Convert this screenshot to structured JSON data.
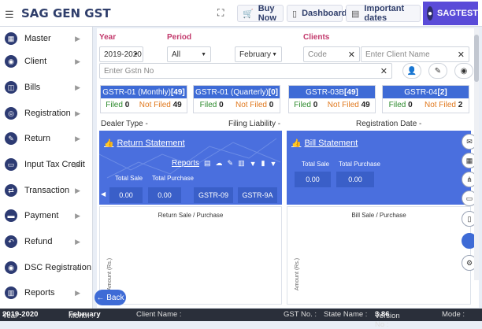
{
  "app": {
    "title": "SAG GEN GST"
  },
  "topbar": {
    "buy_now": "Buy Now",
    "dashboard": "Dashboard",
    "important_dates": "Important dates",
    "user": "SAGTEST"
  },
  "sidebar": {
    "items": [
      {
        "label": "Master",
        "icon": "master-icon"
      },
      {
        "label": "Client",
        "icon": "client-icon"
      },
      {
        "label": "Bills",
        "icon": "bills-icon"
      },
      {
        "label": "Registration",
        "icon": "registration-icon"
      },
      {
        "label": "Return",
        "icon": "return-icon"
      },
      {
        "label": "Input Tax Credit",
        "icon": "input-tax-credit-icon"
      },
      {
        "label": "Transaction",
        "icon": "transaction-icon"
      },
      {
        "label": "Payment",
        "icon": "payment-icon"
      },
      {
        "label": "Refund",
        "icon": "refund-icon"
      },
      {
        "label": "DSC Registration",
        "icon": "dsc-icon"
      },
      {
        "label": "Reports",
        "icon": "reports-icon"
      }
    ]
  },
  "filters": {
    "year_label": "Year",
    "year_value": "2019-2020",
    "period_label": "Period",
    "period_value": "All",
    "month_value": "February",
    "clients_label": "Clients",
    "code_placeholder": "Code",
    "client_name_placeholder": "Enter Client Name",
    "gstn_placeholder": "Enter Gstn No"
  },
  "gst_cards": [
    {
      "title": "GSTR-01 (Monthly) ",
      "count": "[49]",
      "filed_label": "Filed",
      "filed": "0",
      "not_filed_label": "Not Filed",
      "not_filed": "49"
    },
    {
      "title": "GSTR-01 (Quarterly) ",
      "count": "[0]",
      "filed_label": "Filed",
      "filed": "0",
      "not_filed_label": "Not Filed",
      "not_filed": "0"
    },
    {
      "title": "GSTR-03B ",
      "count": "[49]",
      "filed_label": "Filed",
      "filed": "0",
      "not_filed_label": "Not Filed",
      "not_filed": "49"
    },
    {
      "title": "GSTR-04 ",
      "count": "[2]",
      "filed_label": "Filed",
      "filed": "0",
      "not_filed_label": "Not Filed",
      "not_filed": "2"
    }
  ],
  "labels": {
    "dealer_type": "Dealer Type -",
    "filing_liability": "Filing Liability -",
    "registration_date": "Registration Date -"
  },
  "return_statement": {
    "title": "Return Statement",
    "reports": "Reports",
    "total_sale_label": "Total Sale",
    "total_purchase_label": "Total Purchase",
    "total_sale": "0.00",
    "total_purchase": "0.00",
    "gstr09": "GSTR-09",
    "gstr9a": "GSTR-9A"
  },
  "bill_statement": {
    "title": "Bill Statement",
    "total_sale_label": "Total Sale",
    "total_purchase_label": "Total Purchase",
    "total_sale": "0.00",
    "total_purchase": "0.00"
  },
  "charts": {
    "left_title": "Return Sale / Purchase",
    "right_title": "Bill Sale / Purchase",
    "y_label": "Amount (Rs.)"
  },
  "back": "Back",
  "status": {
    "year_label": "Year :",
    "year": "2019-2020",
    "month_label": "Month :",
    "month": "February",
    "client_label": "Client Name :",
    "gst_label": "GST No. :",
    "state_label": "State Name :",
    "version_label": "Version No :",
    "version": "3.86",
    "mode_label": "Mode :"
  },
  "colors": {
    "accent": "#3e6bd6",
    "brand": "#2f3e6b",
    "user_bg": "#5a4bd8",
    "not_filed": "#e0781d",
    "filed": "#2c8a2c",
    "label": "#c2386b"
  }
}
